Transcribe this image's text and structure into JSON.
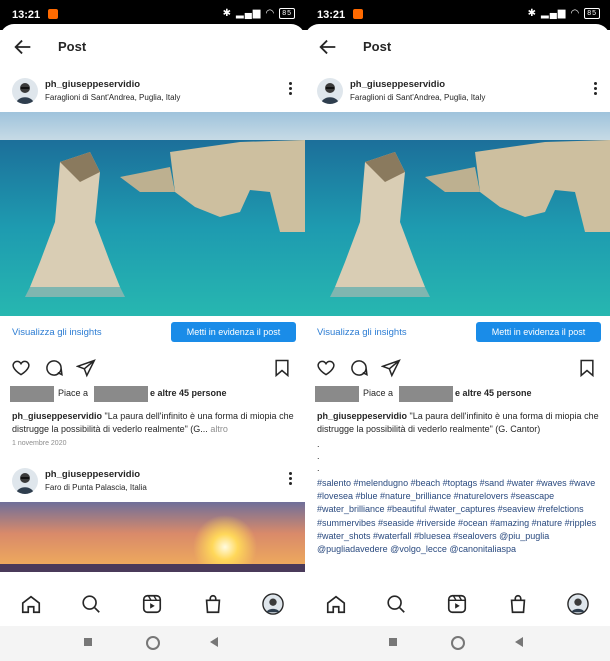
{
  "status": {
    "time": "13:21",
    "battery": "85"
  },
  "topbar": {
    "title": "Post"
  },
  "post": {
    "username": "ph_giuseppeservidio",
    "location": "Faraglioni di Sant'Andrea, Puglia, Italy",
    "insights_link": "Visualizza gli insights",
    "promote_button": "Metti in evidenza il post",
    "likes_prefix": "Piace a",
    "likes_suffix": "e altre 45 persone",
    "caption_text_left": "\"La paura dell'infinito è una forma di miopia che distrugge la possibilità di vederlo realmente\" (G...",
    "caption_more": "altro",
    "caption_text_right": "\"La paura dell'infinito è una forma di miopia che distrugge la possibilità di vederlo realmente\" (G. Cantor)",
    "date": "1 novembre 2020",
    "bullets": ".\n.\n.",
    "hashtags": "#salento #melendugno #beach #toptags #sand #water #waves #wave #lovesea #blue #nature_brilliance #naturelovers #seascape #water_brilliance #beautiful #water_captures #seaview #refelctions #summervibes #seaside #riverside #ocean #amazing #nature #ripples #water_shots #waterfall #bluesea #sealovers @piu_puglia @pugliadavedere @volgo_lecce @canonitaliaspa"
  },
  "next_post": {
    "username": "ph_giuseppeservidio",
    "location": "Faro di Punta Palascia, Italia"
  },
  "icons": {
    "back": "arrow-left-icon",
    "more": "more-vertical-icon",
    "like": "heart-icon",
    "comment": "comment-icon",
    "share": "send-icon",
    "save": "bookmark-icon",
    "home": "home-icon",
    "search": "search-icon",
    "reels": "reels-icon",
    "shop": "shop-icon",
    "profile": "profile-avatar-icon"
  },
  "colors": {
    "accent": "#1a8ce8",
    "link": "#2b7cd3",
    "hashtag": "#2a4a7f"
  }
}
